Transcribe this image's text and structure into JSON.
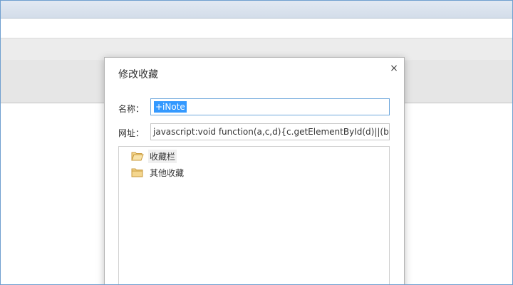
{
  "dialog": {
    "title": "修改收藏",
    "close_glyph": "×",
    "name_label": "名称：",
    "name_value": "+iNote",
    "url_label": "网址：",
    "url_value": "javascript:void function(a,c,d){c.getElementById(d)||(b=c.c"
  },
  "folders": [
    {
      "label": "收藏栏",
      "icon": "folder-open-icon",
      "selected": true
    },
    {
      "label": "其他收藏",
      "icon": "folder-icon",
      "selected": false
    }
  ],
  "colors": {
    "accent_border": "#6fa8dc",
    "selection": "#3399ff",
    "folder_fill": "#f4d68e",
    "folder_stroke": "#c99a3c"
  }
}
